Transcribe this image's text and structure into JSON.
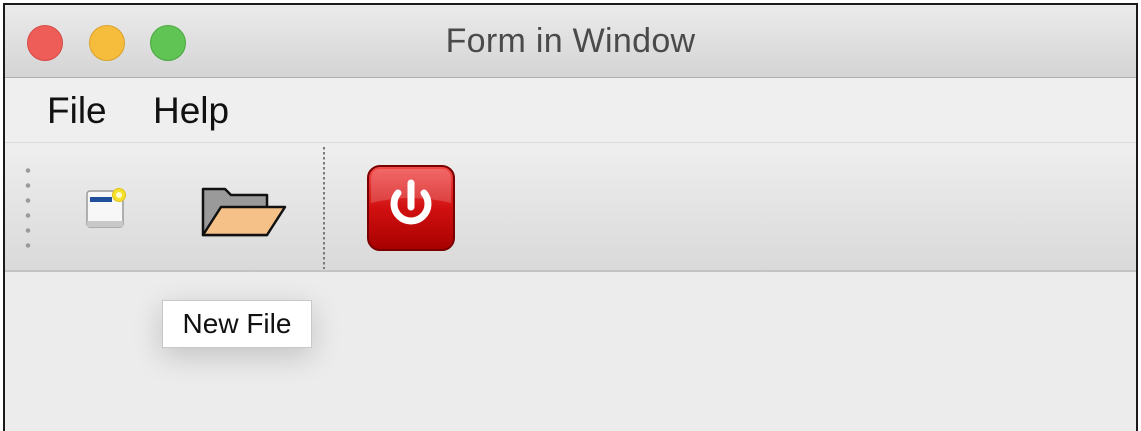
{
  "window": {
    "title": "Form in Window",
    "traffic_lights": {
      "close": "#ee5d58",
      "minimize": "#f6bd3d",
      "maximize": "#5fc453"
    }
  },
  "menubar": {
    "items": [
      {
        "label": "File"
      },
      {
        "label": "Help"
      }
    ]
  },
  "toolbar": {
    "buttons": [
      {
        "icon": "new-file-icon"
      },
      {
        "icon": "open-folder-icon"
      },
      {
        "icon": "power-icon",
        "color": "#d11010"
      }
    ]
  },
  "tooltip": {
    "text": "New File"
  }
}
